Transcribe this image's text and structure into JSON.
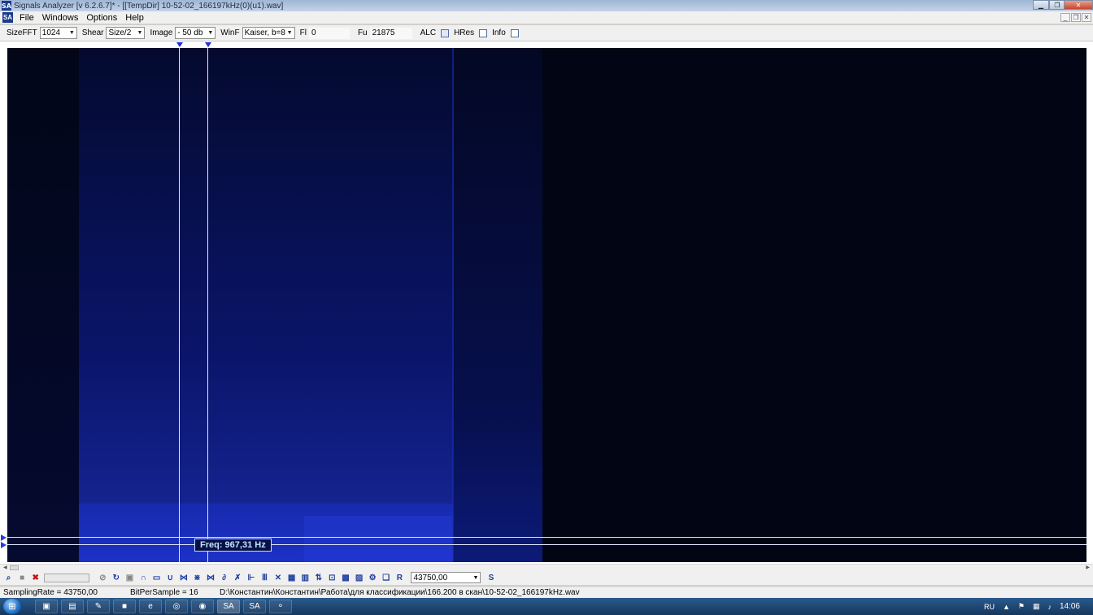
{
  "window": {
    "title": "Signals Analyzer [v 6.2.6.7]* - [[TempDir] 10-52-02_166197kHz(0)(u1).wav]",
    "icon_text": "SA"
  },
  "menu": {
    "items": [
      "File",
      "Windows",
      "Options",
      "Help"
    ]
  },
  "toolbar": {
    "sizefft_label": "SizeFFT",
    "sizefft_value": "1024",
    "shear_label": "Shear",
    "shear_value": "Size/2",
    "image_label": "Image",
    "image_value": "- 50 db",
    "winf_label": "WinF",
    "winf_value": "Kaiser, b=8",
    "fl_label": "Fl",
    "fl_value": "0",
    "fu_label": "Fu",
    "fu_value": "21875",
    "alc_label": "ALC",
    "hres_label": "HRes",
    "info_label": "Info"
  },
  "spectrogram": {
    "freq_readout": "Freq: 967,31 Hz",
    "colors": {
      "background": "#020614",
      "signal": "#1a2fb4",
      "cursor": "#dfe6ff",
      "marker": "#1f2fe0"
    }
  },
  "tools": {
    "rate_value": "43750,00",
    "r_label": "R",
    "s_label": "S",
    "icons": [
      "zoom-icon",
      "stop-icon",
      "delete-icon",
      "slider",
      "disable-icon",
      "loop-icon",
      "box-icon",
      "arc-up-icon",
      "rect-icon",
      "arc-down-icon",
      "marker-a-icon",
      "marker-b-icon",
      "marker-c-icon",
      "dt-icon",
      "x2-icon",
      "filter-icon",
      "bars-icon",
      "cross-icon",
      "grid-icon",
      "columns-icon",
      "split-icon",
      "iq-icon",
      "fft-icon",
      "fft2-icon",
      "gear-icon",
      "copy-icon"
    ]
  },
  "status": {
    "sampling_rate": "SamplingRate = 43750,00",
    "bits": "BitPerSample = 16",
    "path": "D:\\Константин\\Константин\\Работа\\для классификации\\166.200 в скан\\10-52-02_166197kHz.wav"
  },
  "taskbar": {
    "lang": "RU",
    "clock": "14:06"
  }
}
